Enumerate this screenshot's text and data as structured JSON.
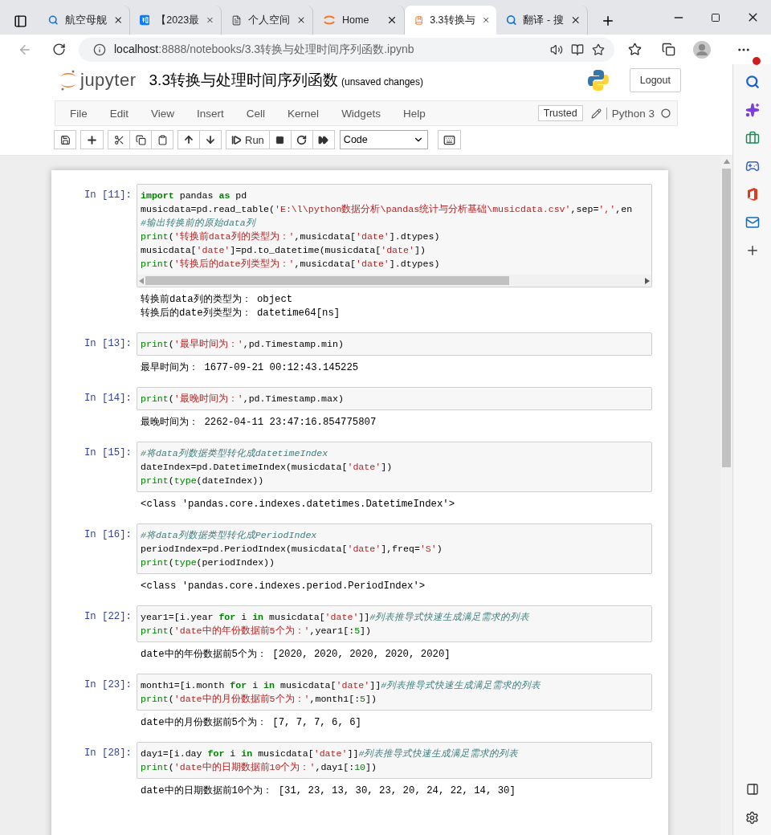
{
  "browser": {
    "tabs": [
      {
        "title": "航空母舰",
        "kind": "search",
        "selected": false
      },
      {
        "title": "【2023最",
        "kind": "zhihu",
        "selected": false
      },
      {
        "title": "个人空间",
        "kind": "page",
        "selected": false
      },
      {
        "title": "Home",
        "kind": "jupyter",
        "selected": false
      },
      {
        "title": "3.3转换与",
        "kind": "book",
        "selected": true
      },
      {
        "title": "翻译 - 搜",
        "kind": "search",
        "selected": false
      }
    ],
    "address": {
      "host": "localhost",
      "path": ":8888/notebooks/3.3转换与处理时间序列函数.ipynb"
    }
  },
  "notebook": {
    "logo_text": "jupyter",
    "title": "3.3转换与处理时间序列函数",
    "status": "(unsaved changes)",
    "logout": "Logout",
    "menu": [
      "File",
      "Edit",
      "View",
      "Insert",
      "Cell",
      "Kernel",
      "Widgets",
      "Help"
    ],
    "trusted": "Trusted",
    "kernel": "Python 3",
    "run": "Run",
    "cell_type": "Code"
  },
  "cells": [
    {
      "prompt": "In [11]:",
      "scrollbar": true,
      "code": [
        [
          {
            "text": "import",
            "kind": "kw"
          },
          {
            "text": " pandas ",
            "kind": "plain"
          },
          {
            "text": "as",
            "kind": "kw"
          },
          {
            "text": " pd",
            "kind": "plain"
          }
        ],
        [
          {
            "text": "musicdata=pd.read_table(",
            "kind": "plain"
          },
          {
            "text": "'E:\\l\\python数据分析\\pandas统计与分析基础\\musicdata.csv'",
            "kind": "str"
          },
          {
            "text": ",sep=",
            "kind": "plain"
          },
          {
            "text": "','",
            "kind": "str"
          },
          {
            "text": ",en",
            "kind": "plain"
          }
        ],
        [
          {
            "text": "#输出转换前的原始data列",
            "kind": "comment"
          }
        ],
        [
          {
            "text": "print",
            "kind": "builtin"
          },
          {
            "text": "(",
            "kind": "plain"
          },
          {
            "text": "'转换前data列的类型为：'",
            "kind": "str"
          },
          {
            "text": ",musicdata[",
            "kind": "plain"
          },
          {
            "text": "'date'",
            "kind": "str"
          },
          {
            "text": "].dtypes)",
            "kind": "plain"
          }
        ],
        [
          {
            "text": "musicdata[",
            "kind": "plain"
          },
          {
            "text": "'date'",
            "kind": "str"
          },
          {
            "text": "]=pd.to_datetime(musicdata[",
            "kind": "plain"
          },
          {
            "text": "'date'",
            "kind": "str"
          },
          {
            "text": "])",
            "kind": "plain"
          }
        ],
        [
          {
            "text": "print",
            "kind": "builtin"
          },
          {
            "text": "(",
            "kind": "plain"
          },
          {
            "text": "'转换后的date列类型为：'",
            "kind": "str"
          },
          {
            "text": ",musicdata[",
            "kind": "plain"
          },
          {
            "text": "'date'",
            "kind": "str"
          },
          {
            "text": "].dtypes)",
            "kind": "plain"
          }
        ]
      ],
      "output": [
        "转换前data列的类型为： object",
        "转换后的date列类型为： datetime64[ns]"
      ]
    },
    {
      "prompt": "In [13]:",
      "scrollbar": false,
      "code": [
        [
          {
            "text": "print",
            "kind": "builtin"
          },
          {
            "text": "(",
            "kind": "plain"
          },
          {
            "text": "'最早时间为：'",
            "kind": "str"
          },
          {
            "text": ",pd.Timestamp.min)",
            "kind": "plain"
          }
        ]
      ],
      "output": [
        "最早时间为： 1677-09-21 00:12:43.145225"
      ]
    },
    {
      "prompt": "In [14]:",
      "scrollbar": false,
      "code": [
        [
          {
            "text": "print",
            "kind": "builtin"
          },
          {
            "text": "(",
            "kind": "plain"
          },
          {
            "text": "'最晚时间为：'",
            "kind": "str"
          },
          {
            "text": ",pd.Timestamp.max)",
            "kind": "plain"
          }
        ]
      ],
      "output": [
        "最晚时间为： 2262-04-11 23:47:16.854775807"
      ]
    },
    {
      "prompt": "In [15]:",
      "scrollbar": false,
      "code": [
        [
          {
            "text": "#将data列数据类型转化成datetimeIndex",
            "kind": "comment"
          }
        ],
        [
          {
            "text": "dateIndex=pd.DatetimeIndex(musicdata[",
            "kind": "plain"
          },
          {
            "text": "'date'",
            "kind": "str"
          },
          {
            "text": "])",
            "kind": "plain"
          }
        ],
        [
          {
            "text": "print",
            "kind": "builtin"
          },
          {
            "text": "(",
            "kind": "plain"
          },
          {
            "text": "type",
            "kind": "builtin"
          },
          {
            "text": "(dateIndex))",
            "kind": "plain"
          }
        ]
      ],
      "output": [
        "<class 'pandas.core.indexes.datetimes.DatetimeIndex'>"
      ]
    },
    {
      "prompt": "In [16]:",
      "scrollbar": false,
      "code": [
        [
          {
            "text": "#将data列数据类型转化成PeriodIndex",
            "kind": "comment"
          }
        ],
        [
          {
            "text": "periodIndex=pd.PeriodIndex(musicdata[",
            "kind": "plain"
          },
          {
            "text": "'date'",
            "kind": "str"
          },
          {
            "text": "],freq=",
            "kind": "plain"
          },
          {
            "text": "'S'",
            "kind": "str"
          },
          {
            "text": ")",
            "kind": "plain"
          }
        ],
        [
          {
            "text": "print",
            "kind": "builtin"
          },
          {
            "text": "(",
            "kind": "plain"
          },
          {
            "text": "type",
            "kind": "builtin"
          },
          {
            "text": "(periodIndex))",
            "kind": "plain"
          }
        ]
      ],
      "output": [
        "<class 'pandas.core.indexes.period.PeriodIndex'>"
      ]
    },
    {
      "prompt": "In [22]:",
      "scrollbar": false,
      "code": [
        [
          {
            "text": "year1=[i.year ",
            "kind": "plain"
          },
          {
            "text": "for",
            "kind": "kw"
          },
          {
            "text": " i ",
            "kind": "plain"
          },
          {
            "text": "in",
            "kind": "kw"
          },
          {
            "text": " musicdata[",
            "kind": "plain"
          },
          {
            "text": "'date'",
            "kind": "str"
          },
          {
            "text": "]]",
            "kind": "plain"
          },
          {
            "text": "#列表推导式快速生成满足需求的列表",
            "kind": "comment"
          }
        ],
        [
          {
            "text": "print",
            "kind": "builtin"
          },
          {
            "text": "(",
            "kind": "plain"
          },
          {
            "text": "'date中的年份数据前5个为：'",
            "kind": "str"
          },
          {
            "text": ",year1[:",
            "kind": "plain"
          },
          {
            "text": "5",
            "kind": "num"
          },
          {
            "text": "])",
            "kind": "plain"
          }
        ]
      ],
      "output": [
        "date中的年份数据前5个为： [2020, 2020, 2020, 2020, 2020]"
      ]
    },
    {
      "prompt": "In [23]:",
      "scrollbar": false,
      "code": [
        [
          {
            "text": "month1=[i.month ",
            "kind": "plain"
          },
          {
            "text": "for",
            "kind": "kw"
          },
          {
            "text": " i ",
            "kind": "plain"
          },
          {
            "text": "in",
            "kind": "kw"
          },
          {
            "text": " musicdata[",
            "kind": "plain"
          },
          {
            "text": "'date'",
            "kind": "str"
          },
          {
            "text": "]]",
            "kind": "plain"
          },
          {
            "text": "#列表推导式快速生成满足需求的列表",
            "kind": "comment"
          }
        ],
        [
          {
            "text": "print",
            "kind": "builtin"
          },
          {
            "text": "(",
            "kind": "plain"
          },
          {
            "text": "'date中的月份数据前5个为：'",
            "kind": "str"
          },
          {
            "text": ",month1[:",
            "kind": "plain"
          },
          {
            "text": "5",
            "kind": "num"
          },
          {
            "text": "])",
            "kind": "plain"
          }
        ]
      ],
      "output": [
        "date中的月份数据前5个为： [7, 7, 7, 6, 6]"
      ]
    },
    {
      "prompt": "In [28]:",
      "scrollbar": false,
      "code": [
        [
          {
            "text": "day1=[i.day ",
            "kind": "plain"
          },
          {
            "text": "for",
            "kind": "kw"
          },
          {
            "text": " i ",
            "kind": "plain"
          },
          {
            "text": "in",
            "kind": "kw"
          },
          {
            "text": " musicdata[",
            "kind": "plain"
          },
          {
            "text": "'date'",
            "kind": "str"
          },
          {
            "text": "]]",
            "kind": "plain"
          },
          {
            "text": "#列表推导式快速生成满足需求的列表",
            "kind": "comment"
          }
        ],
        [
          {
            "text": "print",
            "kind": "builtin"
          },
          {
            "text": "(",
            "kind": "plain"
          },
          {
            "text": "'date中的日期数据前10个为：'",
            "kind": "str"
          },
          {
            "text": ",day1[:",
            "kind": "plain"
          },
          {
            "text": "10",
            "kind": "num"
          },
          {
            "text": "])",
            "kind": "plain"
          }
        ]
      ],
      "output": [
        "date中的日期数据前10个为： [31, 23, 13, 30, 23, 20, 24, 22, 14, 30]"
      ]
    }
  ]
}
